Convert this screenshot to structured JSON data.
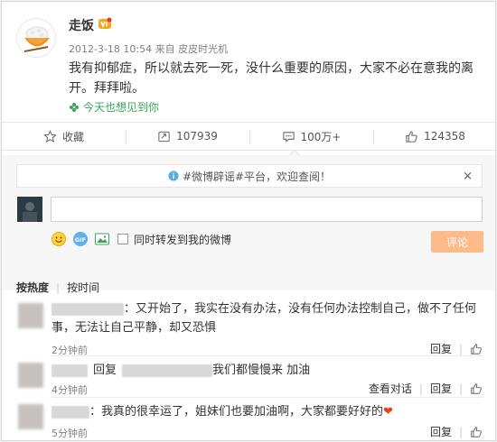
{
  "post": {
    "username": "走饭",
    "meta": "2012-3-18 10:54 来自 皮皮时光机",
    "content": "我有抑郁症，所以就去死一死，没什么重要的原因，大家不必在意我的离开。拜拜啦。",
    "topic": "今天也想见到你"
  },
  "actions": {
    "favorite": "收藏",
    "forward": "107939",
    "comment": "100万+",
    "like": "124358"
  },
  "comment_box": {
    "notice": "#微博辟谣#平台，欢迎查阅！",
    "notice_close": "×",
    "forward_label": "同时转发到我的微博",
    "submit": "评论"
  },
  "sort": {
    "hot": "按热度",
    "time": "按时间"
  },
  "comments": [
    {
      "text": "：又开始了，我实在没有办法，没有任何办法控制自己，做不了任何事，无法让自己平静，却又恐惧",
      "time": "2分钟前",
      "reply": "回复"
    },
    {
      "reply_word": "回复",
      "text": "我们都慢慢来 加油",
      "time": "4分钟前",
      "view": "查看对话",
      "reply": "回复"
    },
    {
      "text": "：我真的很幸运了，姐妹们也要加油啊，大家都要好好的",
      "emoji": "❤",
      "time": "5分钟前",
      "reply": "回复"
    }
  ],
  "colors": {
    "topic_green": "#3aa55c",
    "submit_orange": "#fdbb8b",
    "heart_red": "#e8411f",
    "vip_gold": "#f5a623"
  }
}
